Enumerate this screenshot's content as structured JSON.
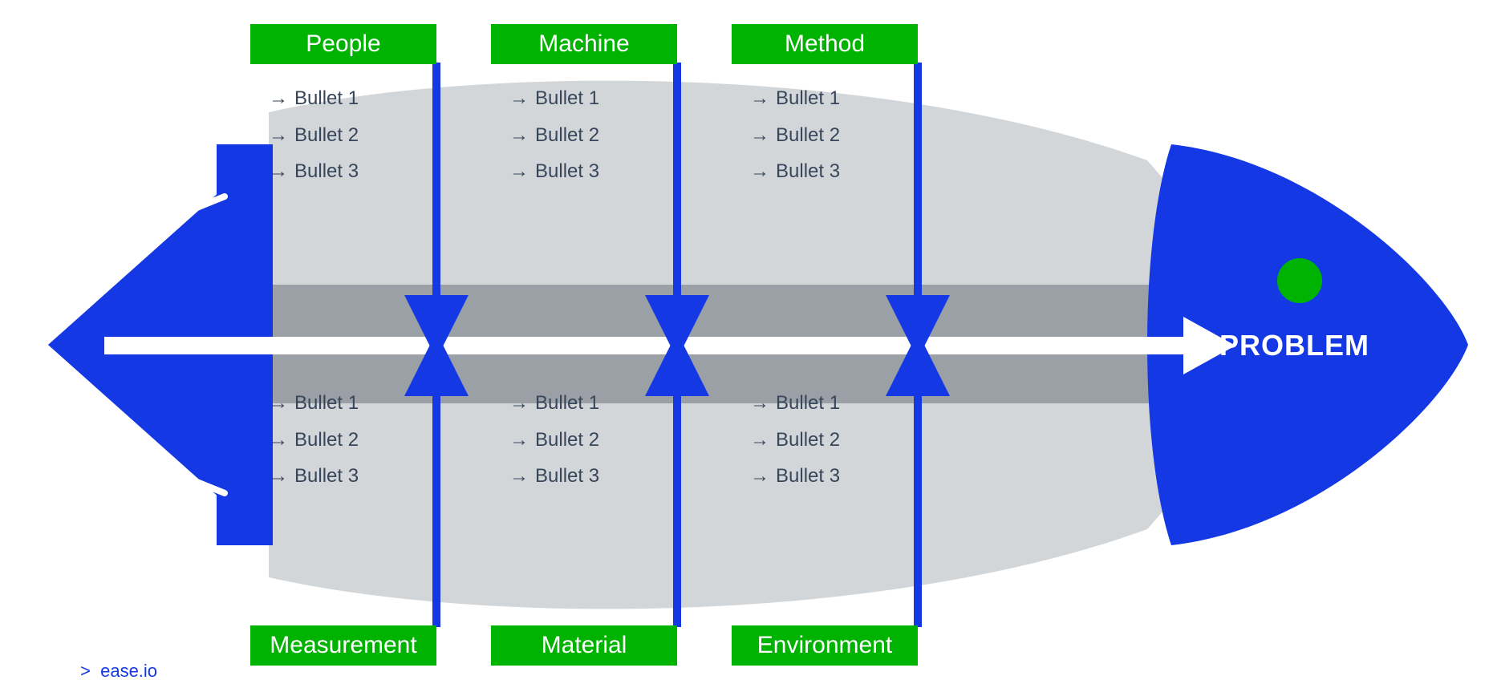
{
  "diagram": {
    "type": "fishbone",
    "head_label": "PROBLEM",
    "colors": {
      "primary_blue": "#1439e4",
      "green": "#00b300",
      "grey_dark": "#9aa0a6",
      "grey_light": "#d3d6d9",
      "pale_blue": "#c8d1f7",
      "bullet_text": "#37465a"
    },
    "top_categories": [
      {
        "label": "People",
        "bullets": [
          "Bullet 1",
          "Bullet 2",
          "Bullet 3"
        ]
      },
      {
        "label": "Machine",
        "bullets": [
          "Bullet 1",
          "Bullet 2",
          "Bullet 3"
        ]
      },
      {
        "label": "Method",
        "bullets": [
          "Bullet 1",
          "Bullet 2",
          "Bullet 3"
        ]
      }
    ],
    "bottom_categories": [
      {
        "label": "Measurement",
        "bullets": [
          "Bullet 1",
          "Bullet 2",
          "Bullet 3"
        ]
      },
      {
        "label": "Material",
        "bullets": [
          "Bullet 1",
          "Bullet 2",
          "Bullet 3"
        ]
      },
      {
        "label": "Environment",
        "bullets": [
          "Bullet 1",
          "Bullet 2",
          "Bullet 3"
        ]
      }
    ],
    "bullet_arrow": "→",
    "attribution_prefix": ">",
    "attribution_text": "ease.io"
  }
}
